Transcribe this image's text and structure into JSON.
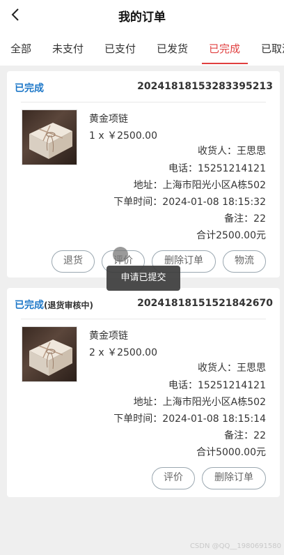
{
  "header": {
    "title": "我的订单",
    "back_icon": "chevron-left-icon"
  },
  "tabs": [
    {
      "label": "全部",
      "active": false
    },
    {
      "label": "未支付",
      "active": false
    },
    {
      "label": "已支付",
      "active": false
    },
    {
      "label": "已发货",
      "active": false
    },
    {
      "label": "已完成",
      "active": true
    },
    {
      "label": "已取消",
      "active": false
    }
  ],
  "orders": [
    {
      "status": "已完成",
      "status_note": "",
      "order_no": "20241818153283395213",
      "product_name": "黄金项链",
      "quantity_price": "1 x ￥2500.00",
      "receiver": "收货人：王思思",
      "phone": "电话：15251214121",
      "address": "地址：上海市阳光小区A栋502",
      "order_time": "下单时间：2024-01-08 18:15:32",
      "remark": "备注：22",
      "total": "合计2500.00元",
      "buttons": [
        "退货",
        "评价",
        "删除订单",
        "物流"
      ]
    },
    {
      "status": "已完成",
      "status_note": "(退货审核中)",
      "order_no": "20241818151521842670",
      "product_name": "黄金项链",
      "quantity_price": "2 x ￥2500.00",
      "receiver": "收货人：王思思",
      "phone": "电话：15251214121",
      "address": "地址：上海市阳光小区A栋502",
      "order_time": "下单时间：2024-01-08 18:15:14",
      "remark": "备注：22",
      "total": "合计5000.00元",
      "buttons": [
        "评价",
        "删除订单"
      ]
    }
  ],
  "toast": "申请已提交",
  "watermark": "CSDN @QQ__1980691580",
  "colors": {
    "accent_red": "#e03f3f",
    "status_blue": "#1e78c8",
    "toast_bg": "#3c3c3c",
    "page_bg": "#efefef"
  }
}
